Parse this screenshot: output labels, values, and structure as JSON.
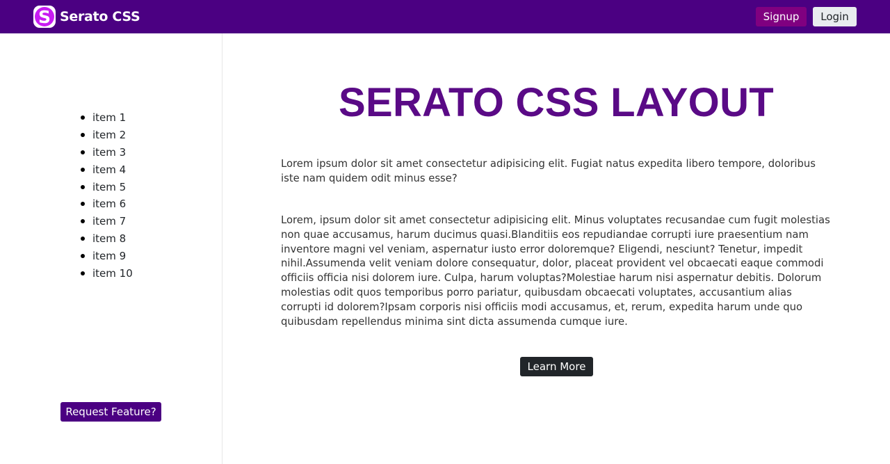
{
  "navbar": {
    "logo_letter": "S",
    "brand": "Serato CSS",
    "signup_label": "Signup",
    "login_label": "Login",
    "colors": {
      "background": "#4b0082",
      "signup": "#800080",
      "login": "#e9ecef"
    }
  },
  "sidebar": {
    "items": [
      {
        "label": "item 1"
      },
      {
        "label": "item 2"
      },
      {
        "label": "item 3"
      },
      {
        "label": "item 4"
      },
      {
        "label": "item 5"
      },
      {
        "label": "item 6"
      },
      {
        "label": "item 7"
      },
      {
        "label": "item 8"
      },
      {
        "label": "item 9"
      },
      {
        "label": "item 10"
      }
    ],
    "request_label": "Request Feature?"
  },
  "main": {
    "title": "SERATO CSS LAYOUT",
    "paragraph1": "Lorem ipsum dolor sit amet consectetur adipisicing elit. Fugiat natus expedita libero tempore, doloribus iste nam quidem odit minus esse?",
    "paragraph2": "Lorem, ipsum dolor sit amet consectetur adipisicing elit. Minus voluptates recusandae cum fugit molestias non quae accusamus, harum ducimus quasi.Blanditiis eos repudiandae corrupti iure praesentium nam inventore magni vel veniam, aspernatur iusto error doloremque? Eligendi, nesciunt? Tenetur, impedit nihil.Assumenda velit veniam dolore consequatur, dolor, placeat provident vel obcaecati eaque commodi officiis officia nisi dolorem iure. Culpa, harum voluptas?Molestiae harum nisi aspernatur debitis. Dolorum molestias odit quos temporibus porro pariatur, quibusdam obcaecati voluptates, accusantium alias corrupti id dolorem?Ipsam corporis nisi officiis modi accusamus, et, rerum, expedita harum unde quo quibusdam repellendus minima sint dicta assumenda cumque iure.",
    "learn_more_label": "Learn More"
  }
}
